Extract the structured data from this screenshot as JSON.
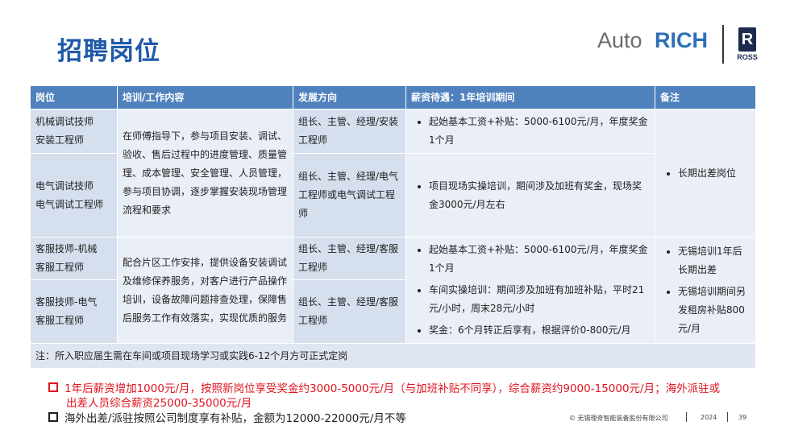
{
  "title": "招聘岗位",
  "logo": {
    "auto": "Auto",
    "rich": "RICH",
    "ross_mark": "R",
    "ross_text": "ROSS"
  },
  "table": {
    "headers": [
      "岗位",
      "培训/工作内容",
      "发展方向",
      "薪资待遇：1年培训期间",
      "备注"
    ],
    "group1": {
      "pos1": [
        "机械调试技师",
        "安装工程师"
      ],
      "pos2": [
        "电气调试技师",
        "电气调试工程师"
      ],
      "training": "在师傅指导下，参与项目安装、调试、验收、售后过程中的进度管理、质量管理、成本管理、安全管理、人员管理，参与项目协调，逐步掌握安装现场管理流程和要求",
      "dev1": "组长、主管、经理/安装工程师",
      "dev2": "组长、主管、经理/电气工程师或电气调试工程师",
      "salary1": "起始基本工资+补贴：5000-6100元/月，年度奖金1个月",
      "salary2": "项目现场实操培训，期间涉及加班有奖金，现场奖金3000元/月左右",
      "remark": "长期出差岗位"
    },
    "group2": {
      "pos1": [
        "客服技师-机械",
        "客服工程师"
      ],
      "pos2": [
        "客服技师-电气",
        "客服工程师"
      ],
      "training": "配合片区工作安排，提供设备安装调试及维修保养服务，对客户进行产品操作培训，设备故障问题排查处理，保障售后服务工作有效落实，实现优质的服务",
      "dev1": "组长、主管、经理/客服工程师",
      "dev2": "组长、主管、经理/客服工程师",
      "salary": [
        "起始基本工资+补贴：5000-6100元/月，年度奖金1个月",
        "车间实操培训：期间涉及加班有加班补贴，平时21元/小时，周末28元/小时",
        "奖金：6个月转正后享有，根据评价0-800元/月"
      ],
      "remarks": [
        "无锡培训1年后长期出差",
        "无锡培训期间另发租房补贴800元/月"
      ]
    },
    "note": "注：所入职应届生需在车间或项目现场学习或实践6-12个月方可正式定岗"
  },
  "footer": {
    "line1a": "1年后薪资增加1000元/月，按照新岗位享受奖金约3000-5000元/月（与加班补贴不同享），综合薪资约9000-15000元/月；海外派驻或",
    "line1b": "出差人员综合薪资25000-35000元/月",
    "line2": "海外出差/派驻按照公司制度享有补贴，金额为12000-22000元/月不等",
    "company": "© 无锡理奇智能装备股份有限公司",
    "year": "2024",
    "page": "39"
  },
  "colors": {
    "title": "#1f5aa8",
    "header_bg": "#4f81bd",
    "cell_dark": "#d6dfee",
    "cell_light": "#e9eef7",
    "highlight": "#e0141e"
  }
}
